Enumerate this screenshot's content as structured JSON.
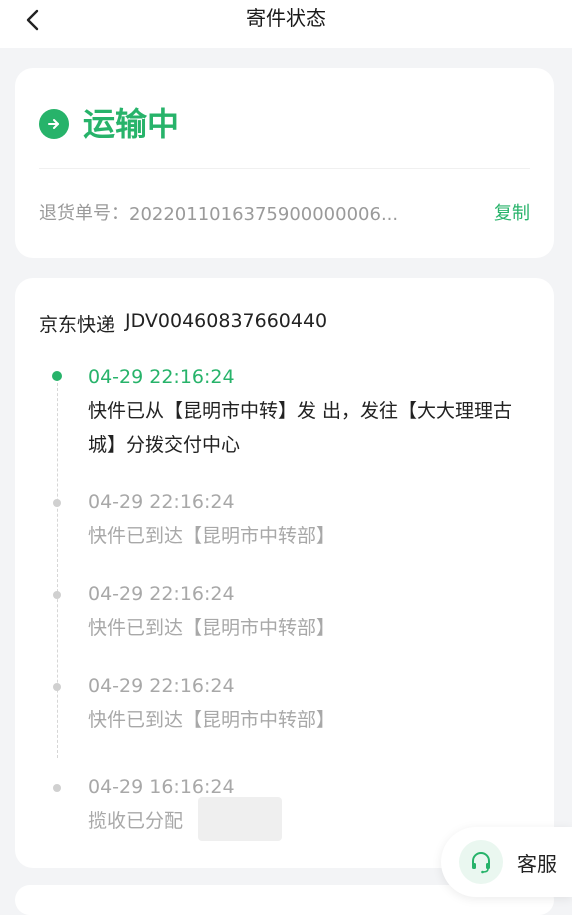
{
  "header": {
    "title": "寄件状态",
    "back_icon": "chevron-left-icon"
  },
  "status": {
    "text": "运输中",
    "icon": "arrow-right-circle-icon",
    "color": "#27b36a"
  },
  "order": {
    "label": "退货单号：",
    "number": "2022011016375900000006...",
    "copy_label": "复制"
  },
  "shipment": {
    "carrier": "京东快递",
    "tracking_number": "JDV00460837660440"
  },
  "events": [
    {
      "time": "04-29 22:16:24",
      "desc": "快件已从【昆明市中转】发 出，发往【大大理理古城】分拨交付中心",
      "active": true
    },
    {
      "time": "04-29 22:16:24",
      "desc": "快件已到达【昆明市中转部】",
      "active": false
    },
    {
      "time": "04-29 22:16:24",
      "desc": "快件已到达【昆明市中转部】",
      "active": false
    },
    {
      "time": "04-29 22:16:24",
      "desc": "快件已到达【昆明市中转部】",
      "active": false
    },
    {
      "time": "04-29 16:16:24",
      "desc": "揽收已分配",
      "active": false
    }
  ],
  "customer_service": {
    "label": "客服",
    "icon": "headset-icon"
  }
}
